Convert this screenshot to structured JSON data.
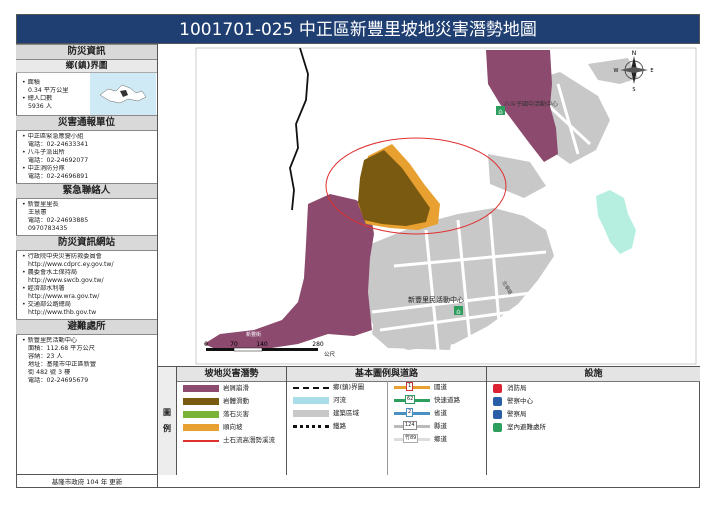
{
  "title": "1001701-025  中正區新豐里坡地災害潛勢地圖",
  "left": {
    "section1": "防災資訊",
    "boundary_map": "鄉(鎮)界圖",
    "area_label": "面積",
    "area_value": "0.34 平方公里",
    "population_label": "總人口數",
    "population_value": "5936 人",
    "section2": "災害通報單位",
    "units": [
      {
        "name": "中正區緊急應變小組",
        "phone": "電話：02-24633341"
      },
      {
        "name": "八斗子派出所",
        "phone": "電話：02-24692077"
      },
      {
        "name": "中正消防分隊",
        "phone": "電話：02-24696891"
      }
    ],
    "section3": "緊急聯絡人",
    "contact_title": "新豐里里長",
    "contact_name": "王慧蕙",
    "contact_phone1": "電話：02-24693885",
    "contact_phone2": "0970783435",
    "section4": "防災資訊網站",
    "sites": [
      {
        "name": "行政院中央災害防救委員會",
        "url": "http://www.cdprc.ey.gov.tw/"
      },
      {
        "name": "農委會水土保持局",
        "url": "http://www.swcb.gov.tw/"
      },
      {
        "name": "經濟部水利署",
        "url": "http://www.wra.gov.tw/"
      },
      {
        "name": "交通部公路總局",
        "url": "http://www.thb.gov.tw"
      }
    ],
    "section5": "避難處所",
    "shelter_name": "新豐里民活動中心",
    "shelter_area": "面積：112.68 平方公尺",
    "shelter_capacity": "容納：23 人",
    "shelter_addr1": "地址：基隆市中正區新豐",
    "shelter_addr2": "街 482 號 3 樓",
    "shelter_phone": "電話：02-24695679",
    "footer": "基隆市政府 104 年  更新"
  },
  "map": {
    "community_center_label": "新豐里民活動中心",
    "activity_center_label": "八斗子國中活動中心",
    "road_label_1": "新豐街",
    "road_label_2": "北寧路",
    "scale_ticks": [
      "0",
      "70",
      "140",
      "280"
    ],
    "scale_unit": "公尺",
    "north_label": "N",
    "east_label": "E",
    "south_label": "S",
    "west_label": "W"
  },
  "legend": {
    "side_label_top": "圖",
    "side_label_bottom": "例",
    "hazard_title": "坡地災害潛勢",
    "hazard_items": [
      "岩屑崩滑",
      "岩體滑動",
      "落石災害",
      "順向坡",
      "土石流高潛勢溪流"
    ],
    "base_title": "基本圖例與道路",
    "base_items": [
      "鄉(鎮)界圖",
      "河流",
      "建築區域",
      "鐵路"
    ],
    "road_items": [
      "國道",
      "快速道路",
      "省道",
      "縣道",
      "鄉道"
    ],
    "road_numbers": [
      "1",
      "62",
      "2",
      "124",
      "竹89"
    ],
    "facility_title": "設施",
    "facility_items": [
      "消防局",
      "警察中心",
      "警察局",
      "室內避難處所"
    ],
    "colors": {
      "debris": "#8b4a6e",
      "rock": "#7a5a10",
      "rockfall": "#7ab335",
      "dip": "#e8a030",
      "stream": "#e03030",
      "building": "#c8c8c8",
      "river": "#a9dde8",
      "water": "#b6efe0"
    }
  }
}
